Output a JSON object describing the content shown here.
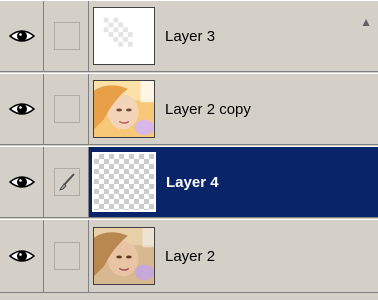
{
  "layers_panel": {
    "layers": [
      {
        "name": "Layer 3",
        "visible": true,
        "selected": false,
        "link_icon": "empty",
        "thumbnail": "transparent-mostly-blank"
      },
      {
        "name": "Layer 2 copy",
        "visible": true,
        "selected": false,
        "link_icon": "empty",
        "thumbnail": "photo-face-bright"
      },
      {
        "name": "Layer 4",
        "visible": true,
        "selected": true,
        "link_icon": "paintbrush-icon",
        "thumbnail": "transparent"
      },
      {
        "name": "Layer 2",
        "visible": true,
        "selected": false,
        "link_icon": "empty",
        "thumbnail": "photo-face"
      }
    ],
    "colors": {
      "panel_bg": "#d4d0c8",
      "selection": "#0a246a",
      "selected_text": "#ffffff"
    }
  }
}
